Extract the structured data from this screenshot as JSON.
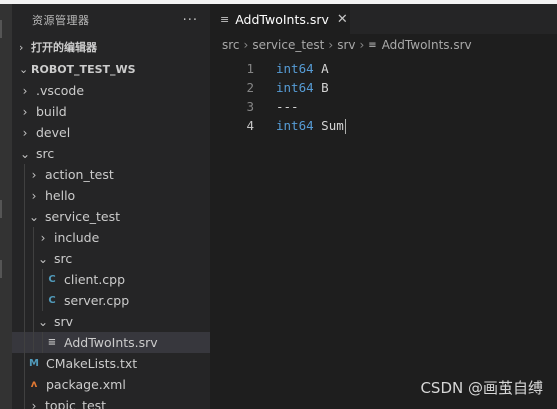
{
  "sidebar": {
    "title": "资源管理器",
    "more_label": "···",
    "open_editors": "打开的编辑器",
    "workspace": "ROBOT_TEST_WS"
  },
  "tree": [
    {
      "label": ".vscode",
      "expanded": false,
      "kind": "folder"
    },
    {
      "label": "build",
      "expanded": false,
      "kind": "folder"
    },
    {
      "label": "devel",
      "expanded": false,
      "kind": "folder"
    },
    {
      "label": "src",
      "expanded": true,
      "kind": "folder"
    },
    {
      "label": "action_test",
      "expanded": false,
      "kind": "folder"
    },
    {
      "label": "hello",
      "expanded": false,
      "kind": "folder"
    },
    {
      "label": "service_test",
      "expanded": true,
      "kind": "folder"
    },
    {
      "label": "include",
      "expanded": false,
      "kind": "folder"
    },
    {
      "label": "src",
      "expanded": true,
      "kind": "folder"
    },
    {
      "label": "client.cpp",
      "kind": "cpp",
      "icon": "C"
    },
    {
      "label": "server.cpp",
      "kind": "cpp",
      "icon": "C"
    },
    {
      "label": "srv",
      "expanded": true,
      "kind": "folder"
    },
    {
      "label": "AddTwoInts.srv",
      "kind": "srv",
      "icon": "≡",
      "selected": true
    },
    {
      "label": "CMakeLists.txt",
      "kind": "cmake",
      "icon": "M"
    },
    {
      "label": "package.xml",
      "kind": "xml",
      "icon": "ʌ"
    },
    {
      "label": "topic_test",
      "expanded": false,
      "kind": "folder"
    }
  ],
  "editor": {
    "tab_label": "AddTwoInts.srv",
    "breadcrumb": [
      "src",
      "service_test",
      "srv",
      "AddTwoInts.srv"
    ],
    "lines": [
      {
        "n": "1",
        "type": "int64",
        "name": "A"
      },
      {
        "n": "2",
        "type": "int64",
        "name": "B"
      },
      {
        "n": "3",
        "type": "",
        "name": "---"
      },
      {
        "n": "4",
        "type": "int64",
        "name": "Sum"
      }
    ]
  },
  "watermark": "CSDN @画茧自缚",
  "colors": {
    "keyword": "#569cd6",
    "cpp_icon": "#519aba",
    "cmake_icon": "#519aba",
    "xml_icon": "#e37933",
    "srv_icon": "#c5c5c5"
  }
}
